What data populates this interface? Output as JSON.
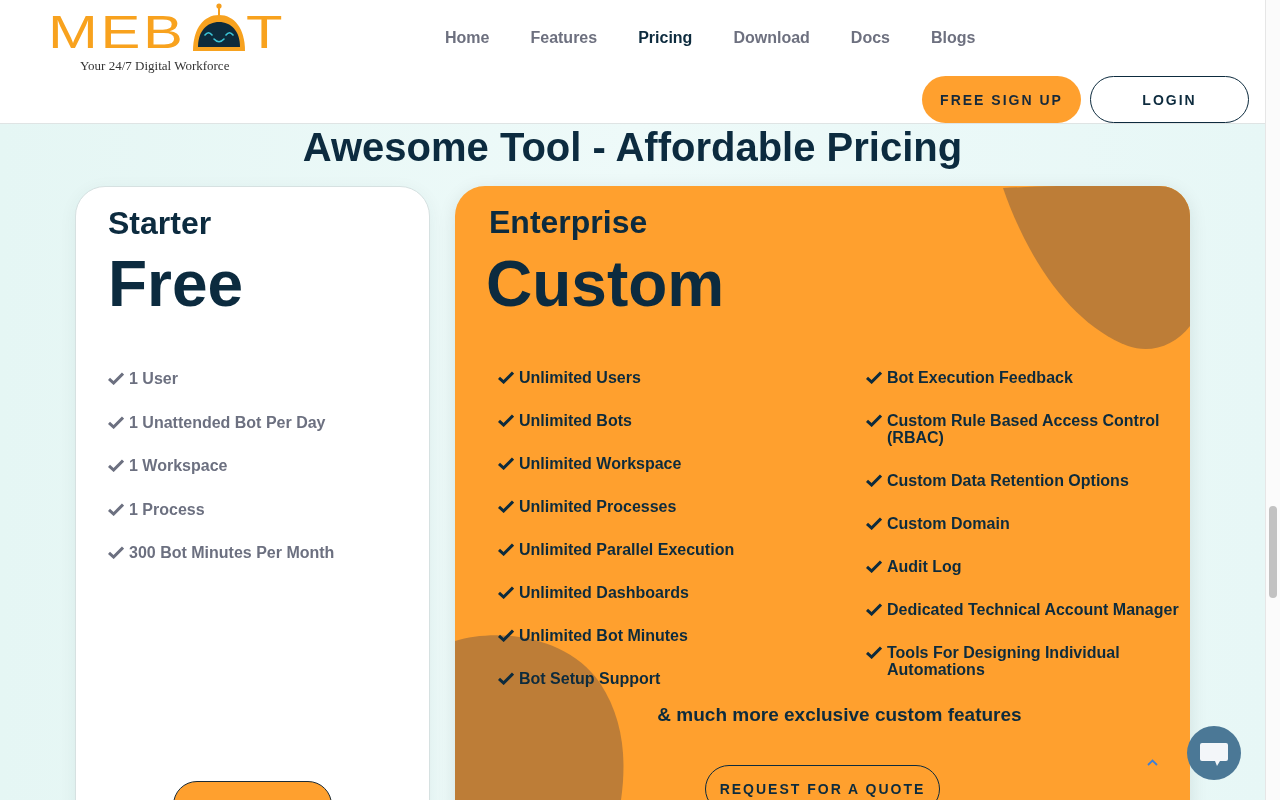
{
  "header": {
    "logo": {
      "wordmark_start": "MEB",
      "wordmark_end": "T",
      "tagline": "Your 24/7 Digital Workforce"
    },
    "nav": [
      {
        "label": "Home",
        "selected": false
      },
      {
        "label": "Features",
        "selected": false
      },
      {
        "label": "Pricing",
        "selected": true
      },
      {
        "label": "Download",
        "selected": false
      },
      {
        "label": "Docs",
        "selected": false
      },
      {
        "label": "Blogs",
        "selected": false
      }
    ],
    "buttons": [
      {
        "label": "FREE SIGN UP",
        "kind": "filled"
      },
      {
        "label": "LOGIN",
        "kind": "outline"
      }
    ]
  },
  "heading": "Awesome Tool - Affordable Pricing",
  "plans": [
    {
      "kind": "basic",
      "name": "Starter",
      "price": "Free",
      "feature_columns": [
        [
          "1 User",
          "1 Unattended Bot Per Day",
          "1 Workspace",
          "1 Process",
          "300 Bot Minutes Per Month"
        ]
      ],
      "button": {
        "kind": "filled"
      }
    },
    {
      "kind": "featured",
      "name": "Enterprise",
      "price": "Custom",
      "feature_columns": [
        [
          "Unlimited Users",
          "Unlimited Bots",
          "Unlimited Workspace",
          "Unlimited Processes",
          "Unlimited Parallel Execution",
          "Unlimited Dashboards",
          "Unlimited Bot Minutes",
          "Bot Setup Support"
        ],
        [
          "Bot Execution Feedback",
          "Custom Rule Based Access Control (RBAC)",
          "Custom Data Retention Options",
          "Custom Domain",
          "Audit Log",
          "Dedicated Technical Account Manager",
          "Tools For Designing Individual Automations"
        ]
      ],
      "note": "& much more exclusive custom features",
      "button": {
        "kind": "outline",
        "label": "REQUEST FOR A QUOTE"
      }
    }
  ]
}
